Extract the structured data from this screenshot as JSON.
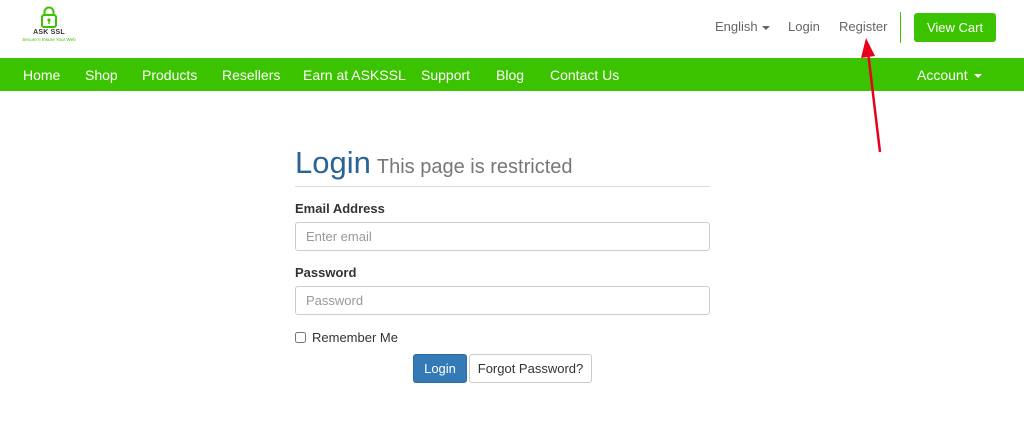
{
  "brand": {
    "name": "ASK SSL",
    "tagline": "Secure n Insure Your Web",
    "accent_color": "#3cc300",
    "icon": "padlock-icon"
  },
  "header": {
    "language": "English",
    "login": "Login",
    "register": "Register",
    "view_cart": "View Cart"
  },
  "nav": {
    "items": [
      "Home",
      "Shop",
      "Products",
      "Resellers",
      "Earn at ASKSSL",
      "Support",
      "Blog",
      "Contact Us"
    ],
    "account": "Account"
  },
  "login_form": {
    "title": "Login",
    "subtitle": "This page is restricted",
    "email_label": "Email Address",
    "email_placeholder": "Enter email",
    "email_value": "",
    "password_label": "Password",
    "password_placeholder": "Password",
    "password_value": "",
    "remember_label": "Remember Me",
    "remember_checked": false,
    "login_button": "Login",
    "forgot_button": "Forgot Password?"
  },
  "annotation": {
    "color": "#e8001c",
    "icon": "red-arrow-pointing-to-register"
  }
}
